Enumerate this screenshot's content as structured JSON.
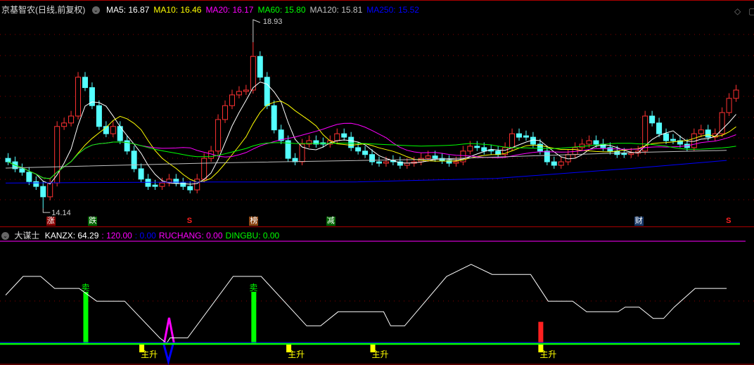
{
  "header": {
    "title": "京基智农(日线,前复权)",
    "ma": [
      {
        "label": "MA5: 16.87",
        "color": "#ffffff"
      },
      {
        "label": "MA10: 16.46",
        "color": "#ffff00"
      },
      {
        "label": "MA20: 16.17",
        "color": "#ff00ff"
      },
      {
        "label": "MA60: 15.80",
        "color": "#00ff00"
      },
      {
        "label": "MA120: 15.81",
        "color": "#c0c0c0"
      },
      {
        "label": "MA250: 15.52",
        "color": "#0000ff"
      }
    ]
  },
  "annotations": {
    "high": "18.93",
    "low": "14.14"
  },
  "markers": [
    {
      "text": "涨",
      "bg": "#8b0000",
      "color": "#fff",
      "bar": 6
    },
    {
      "text": "跌",
      "bg": "#006400",
      "color": "#fff",
      "bar": 12
    },
    {
      "text": "S",
      "bg": "transparent",
      "color": "#ff2020",
      "bar": 26
    },
    {
      "text": "榜",
      "bg": "#8b4513",
      "color": "#fff",
      "bar": 35
    },
    {
      "text": "减",
      "bg": "#006400",
      "color": "#fff",
      "bar": 46
    },
    {
      "text": "财",
      "bg": "#1a3a6a",
      "color": "#fff",
      "bar": 90
    },
    {
      "text": "S",
      "bg": "transparent",
      "color": "#ff2020",
      "bar": 103
    }
  ],
  "indicator": {
    "name": "大谋士",
    "values": [
      {
        "label": "KANZX: 64.29",
        "color": "#ffffff"
      },
      {
        "label": ": 120.00",
        "color": "#ff00ff"
      },
      {
        "label": ": 0.00",
        "color": "#0000ff"
      },
      {
        "label": "RUCHANG: 0.00",
        "color": "#ff00ff"
      },
      {
        "label": "DINGBU: 0.00",
        "color": "#00ff00"
      }
    ],
    "sell_label": "卖",
    "rise_label": "主升"
  },
  "chart_data": {
    "type": "candlestick",
    "title": "京基智农(日线,前复权)",
    "ylim": [
      13.9,
      19.4
    ],
    "closes": [
      15.48,
      15.28,
      15.18,
      14.91,
      14.77,
      14.47,
      14.87,
      16.5,
      16.6,
      16.8,
      17.92,
      17.62,
      17.1,
      16.5,
      16.29,
      16.5,
      16.09,
      15.79,
      15.28,
      14.98,
      14.77,
      14.77,
      14.87,
      14.98,
      14.87,
      14.77,
      14.67,
      14.98,
      15.58,
      15.79,
      16.7,
      17.1,
      17.41,
      17.51,
      17.55,
      18.52,
      17.92,
      17.1,
      16.4,
      16.09,
      15.58,
      15.48,
      15.99,
      16.09,
      15.99,
      15.99,
      16.09,
      16.29,
      16.19,
      15.89,
      15.79,
      15.69,
      15.48,
      15.44,
      15.48,
      15.48,
      15.38,
      15.44,
      15.48,
      15.58,
      15.65,
      15.58,
      15.52,
      15.44,
      15.48,
      15.79,
      15.93,
      15.89,
      15.79,
      15.79,
      15.69,
      15.89,
      16.29,
      16.19,
      16.19,
      15.99,
      15.79,
      15.48,
      15.38,
      15.48,
      15.69,
      15.89,
      15.99,
      16.09,
      15.99,
      15.89,
      15.79,
      15.69,
      15.69,
      15.73,
      15.79,
      16.8,
      16.6,
      16.29,
      16.09,
      16.09,
      15.99,
      15.89,
      16.29,
      16.4,
      16.19,
      16.29,
      16.9,
      17.31,
      17.55
    ],
    "high_bar": 35,
    "high": 18.93,
    "low_bar": 5,
    "low": 14.14,
    "ma120": [
      [
        0,
        15.3
      ],
      [
        30,
        15.45
      ],
      [
        60,
        15.55
      ],
      [
        90,
        15.75
      ],
      [
        103,
        15.81
      ]
    ],
    "ma250": [
      [
        0,
        14.87
      ],
      [
        30,
        14.9
      ],
      [
        50,
        14.9
      ],
      [
        70,
        15.0
      ],
      [
        90,
        15.3
      ],
      [
        103,
        15.52
      ]
    ],
    "indicator_ylim": [
      0,
      120
    ],
    "kanzx": [
      [
        0,
        72
      ],
      [
        2.5,
        100
      ],
      [
        5,
        100
      ],
      [
        7,
        82
      ],
      [
        10.5,
        82
      ],
      [
        13,
        63
      ],
      [
        17,
        63
      ],
      [
        22,
        8
      ],
      [
        23,
        0
      ],
      [
        23.5,
        8
      ],
      [
        26,
        8
      ],
      [
        32.5,
        100
      ],
      [
        36.5,
        100
      ],
      [
        43,
        26
      ],
      [
        45,
        26
      ],
      [
        47.5,
        47
      ],
      [
        54,
        47
      ],
      [
        55,
        26
      ],
      [
        57,
        26
      ],
      [
        63,
        100
      ],
      [
        66.5,
        118
      ],
      [
        69.5,
        103
      ],
      [
        75,
        103
      ],
      [
        77.5,
        63
      ],
      [
        81,
        63
      ],
      [
        83,
        47
      ],
      [
        87.5,
        47
      ],
      [
        88.5,
        54
      ],
      [
        90.5,
        54
      ],
      [
        92.5,
        37
      ],
      [
        94,
        37
      ],
      [
        95.5,
        54
      ],
      [
        98.5,
        82
      ],
      [
        103,
        82
      ]
    ],
    "sell_bars": [
      [
        11,
        77
      ],
      [
        35,
        77
      ]
    ],
    "red_bars": [
      [
        76,
        32
      ]
    ],
    "rise_bars": [
      19,
      40,
      52,
      76
    ],
    "spike_bar": 23
  }
}
